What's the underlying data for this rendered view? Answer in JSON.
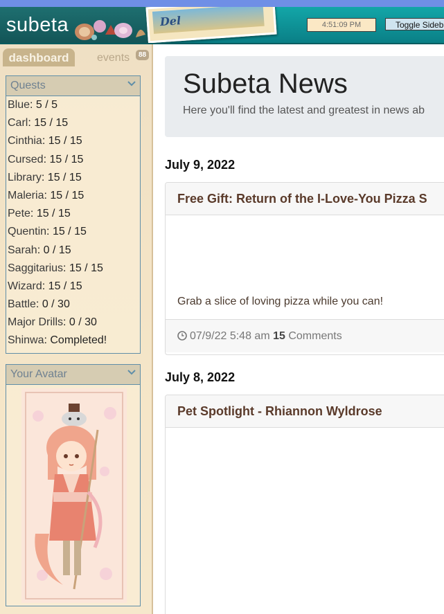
{
  "header": {
    "logo": "subeta",
    "banner_word": "Del",
    "clock": "4:51:09 PM",
    "toggle_sidebar": "Toggle Sideb"
  },
  "sidebar": {
    "tabs": {
      "dashboard": "dashboard",
      "events": "events",
      "events_count": "88"
    },
    "quests": {
      "title": "Quests",
      "items": [
        {
          "name": "Blue",
          "value": ": 5 / 5"
        },
        {
          "name": "Carl",
          "value": ": 15 / 15"
        },
        {
          "name": "Cinthia",
          "value": ": 15 / 15"
        },
        {
          "name": "Cursed",
          "value": ": 15 / 15"
        },
        {
          "name": "Library",
          "value": ": 15 / 15"
        },
        {
          "name": "Maleria",
          "value": ": 15 / 15"
        },
        {
          "name": "Pete",
          "value": ": 15 / 15"
        },
        {
          "name": "Quentin",
          "value": ": 15 / 15"
        },
        {
          "name": "Sarah",
          "value": ": 0 / 15"
        },
        {
          "name": "Saggitarius",
          "value": ": 15 / 15"
        },
        {
          "name": "Wizard",
          "value": ": 15 / 15"
        },
        {
          "name": "Battle",
          "value": ": 0 / 30"
        },
        {
          "name": "Major Drills",
          "value": ": 0 / 30"
        },
        {
          "name": "Shinwa",
          "value": ": Completed!"
        }
      ]
    },
    "avatar": {
      "title": "Your Avatar"
    }
  },
  "main": {
    "title": "Subeta News",
    "subtitle": "Here you'll find the latest and greatest in news ab",
    "posts": [
      {
        "date": "July 9, 2022",
        "title": "Free Gift: Return of the I-Love-You Pizza S",
        "body": "Grab a slice of loving pizza while you can!",
        "timestamp": "07/9/22 5:48 am",
        "comment_count": "15",
        "comments_label": "Comments"
      },
      {
        "date": "July 8, 2022",
        "title": "Pet Spotlight - Rhiannon Wyldrose"
      }
    ]
  },
  "colors": {
    "header_teal": "#0f9aa0",
    "sidebar_bg": "#f4e4c6",
    "panel_border": "#5f8ea8",
    "post_title": "#5a3a2a"
  }
}
